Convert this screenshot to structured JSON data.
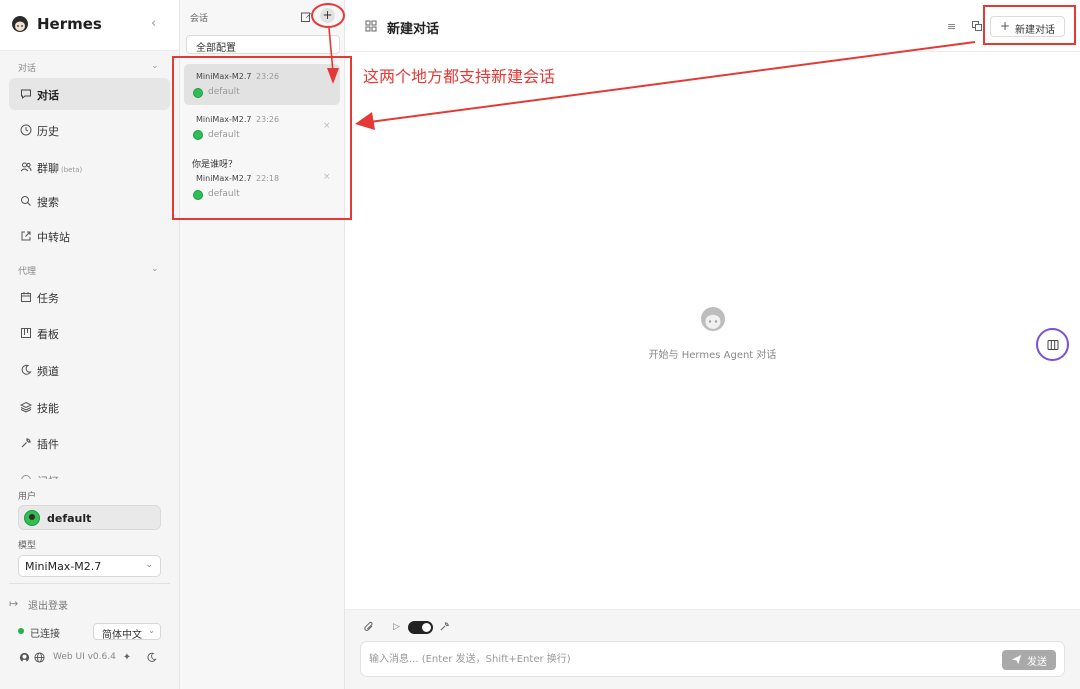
{
  "brand": {
    "title": "Hermes",
    "collapse_glyph": "‹"
  },
  "sidebar": {
    "sections": {
      "chat": "对话",
      "agent": "代理"
    },
    "chat_items": [
      {
        "label": "对话",
        "icon": "chat-bubble-icon"
      },
      {
        "label": "历史",
        "icon": "clock-icon"
      },
      {
        "label": "群聊",
        "sub": "(beta)",
        "icon": "users-icon"
      },
      {
        "label": "搜索",
        "icon": "search-icon"
      },
      {
        "label": "中转站",
        "icon": "external-link-icon"
      }
    ],
    "agent_items": [
      {
        "label": "任务",
        "icon": "calendar-icon"
      },
      {
        "label": "看板",
        "icon": "kanban-icon"
      },
      {
        "label": "频道",
        "icon": "moon-icon"
      },
      {
        "label": "技能",
        "icon": "layers-icon"
      },
      {
        "label": "插件",
        "icon": "wrench-icon"
      },
      {
        "label": "记忆",
        "icon": "memory-icon"
      }
    ],
    "user_label": "用户",
    "user_name": "default",
    "model_label": "模型",
    "model_value": "MiniMax-M2.7",
    "logout": "退出登录",
    "connection": "已连接",
    "language": "简体中文",
    "version": "Web UI v0.6.4"
  },
  "sessions": {
    "title": "会话",
    "filter": "全部配置",
    "items": [
      {
        "question": "",
        "model": "MiniMax-M2.7",
        "time": "23:26",
        "profile": "default"
      },
      {
        "question": "",
        "model": "MiniMax-M2.7",
        "time": "23:26",
        "profile": "default"
      },
      {
        "question": "你是谁呀？",
        "model": "MiniMax-M2.7",
        "time": "22:18",
        "profile": "default"
      }
    ]
  },
  "main": {
    "title": "新建对话",
    "new_chat_label": "新建对话",
    "empty_text": "开始与 Hermes Agent 对话",
    "input_placeholder": "输入消息... (Enter 发送，Shift+Enter 换行)",
    "send_label": "发送"
  },
  "annotation": {
    "text": "这两个地方都支持新建会话",
    "color": "#e53935"
  }
}
